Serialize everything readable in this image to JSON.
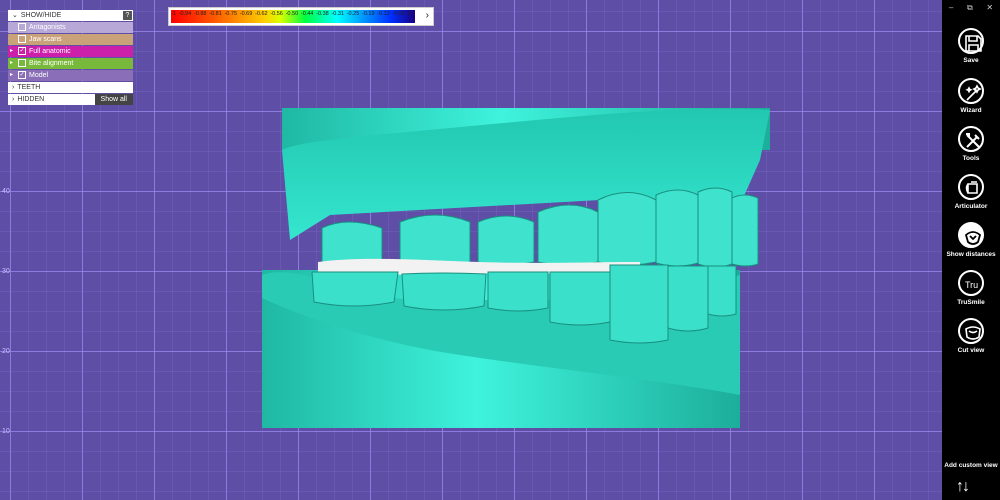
{
  "colorscale": {
    "labels": [
      "-1",
      "-0.94",
      "-0.88",
      "-0.81",
      "-0.75",
      "-0.69",
      "-0.62",
      "-0.56",
      "-0.50",
      "-0.44",
      "-0.38",
      "-0.31",
      "-0.25",
      "-0.19",
      "-0.12",
      "-0.06",
      "0"
    ],
    "expand_icon": "chevron-right-icon"
  },
  "axis": {
    "ticks": [
      "40",
      "30",
      "20",
      "10"
    ]
  },
  "panel": {
    "header": "SHOW/HIDE",
    "help": "?",
    "items": [
      {
        "label": "Antagonists",
        "checked": false,
        "color": "#b8a8d8"
      },
      {
        "label": "Jaw scans",
        "checked": false,
        "color": "#c9a27a"
      },
      {
        "label": "Full anatomic",
        "checked": true,
        "color": "#cc1faa"
      },
      {
        "label": "Bite alignment",
        "checked": false,
        "color": "#78b83a"
      },
      {
        "label": "Model",
        "checked": true,
        "color": "#8a6fb8"
      }
    ],
    "teeth": "TEETH",
    "hidden": "HIDDEN",
    "show_all": "Show all"
  },
  "sidebar": {
    "window_controls": [
      "‒",
      "⧉",
      "✕"
    ],
    "tools": [
      {
        "label": "Save",
        "icon": "save-icon"
      },
      {
        "label": "Wizard",
        "icon": "wizard-wand-icon"
      },
      {
        "label": "Tools",
        "icon": "tools-icon"
      },
      {
        "label": "Articulator",
        "icon": "articulator-icon"
      },
      {
        "label": "Show distances",
        "icon": "show-distances-icon",
        "active": true
      },
      {
        "label": "TruSmile",
        "icon": "trusmile-icon"
      },
      {
        "label": "Cut view",
        "icon": "cut-view-icon"
      }
    ],
    "add_custom_view": "Add custom view",
    "updown": "↑↓"
  }
}
